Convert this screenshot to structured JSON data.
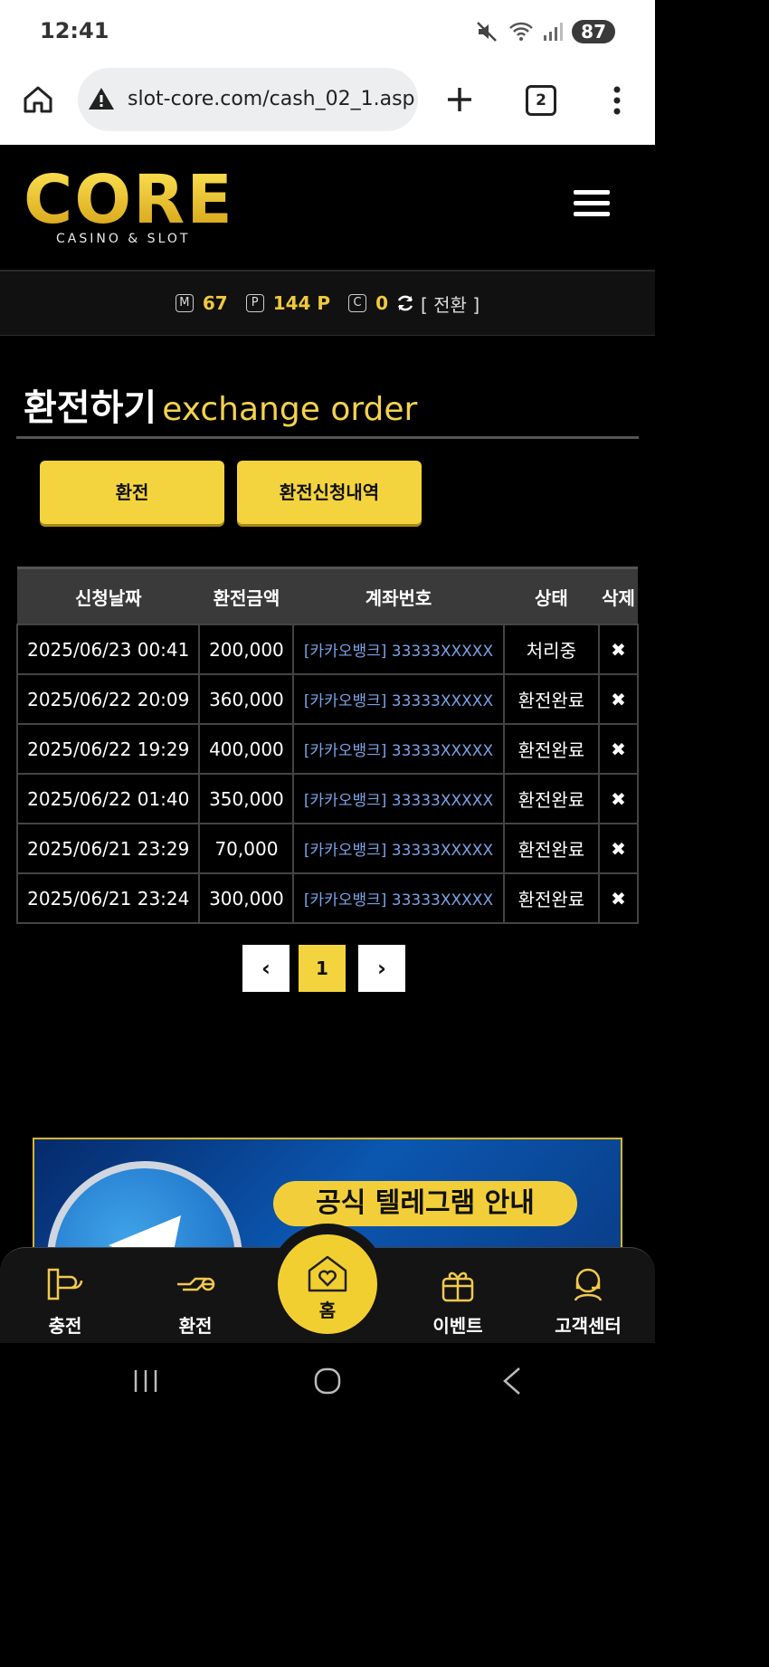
{
  "status_bar": {
    "time": "12:41",
    "battery": "87",
    "icons": [
      "mute-icon",
      "wifi-icon",
      "signal-icon"
    ]
  },
  "browser": {
    "url": "slot-core.com/cash_02_1.asp",
    "tab_count": "2"
  },
  "site": {
    "logo_text": "CORE",
    "logo_subtitle": "CASINO & SLOT",
    "points": {
      "m_label": "M",
      "m_value": "67",
      "p_label": "P",
      "p_value": "144 P",
      "c_label": "C",
      "c_value": "0",
      "convert_label": "[ 전환 ]"
    }
  },
  "page": {
    "title_ko": "환전하기",
    "title_en": "exchange order",
    "btn_exchange": "환전",
    "btn_history": "환전신청내역"
  },
  "table": {
    "headers": [
      "신청날짜",
      "환전금액",
      "계좌번호",
      "상태",
      "삭제"
    ],
    "rows": [
      {
        "date": "2025/06/23 00:41",
        "amount": "200,000",
        "account": "[카카오뱅크] 33333XXXXX",
        "status": "처리중"
      },
      {
        "date": "2025/06/22 20:09",
        "amount": "360,000",
        "account": "[카카오뱅크] 33333XXXXX",
        "status": "환전완료"
      },
      {
        "date": "2025/06/22 19:29",
        "amount": "400,000",
        "account": "[카카오뱅크] 33333XXXXX",
        "status": "환전완료"
      },
      {
        "date": "2025/06/22 01:40",
        "amount": "350,000",
        "account": "[카카오뱅크] 33333XXXXX",
        "status": "환전완료"
      },
      {
        "date": "2025/06/21 23:29",
        "amount": "70,000",
        "account": "[카카오뱅크] 33333XXXXX",
        "status": "환전완료"
      },
      {
        "date": "2025/06/21 23:24",
        "amount": "300,000",
        "account": "[카카오뱅크] 33333XXXXX",
        "status": "환전완료"
      }
    ]
  },
  "pagination": {
    "prev": "‹",
    "current": "1",
    "next": "›"
  },
  "banner": {
    "title": "공식 텔레그램 안내"
  },
  "bottom_nav": {
    "charge": "충전",
    "exchange": "환전",
    "home": "홈",
    "event": "이벤트",
    "support": "고객센터"
  },
  "colors": {
    "accent": "#f4d43e",
    "account_link": "#7aa2e6",
    "background": "#000000"
  }
}
